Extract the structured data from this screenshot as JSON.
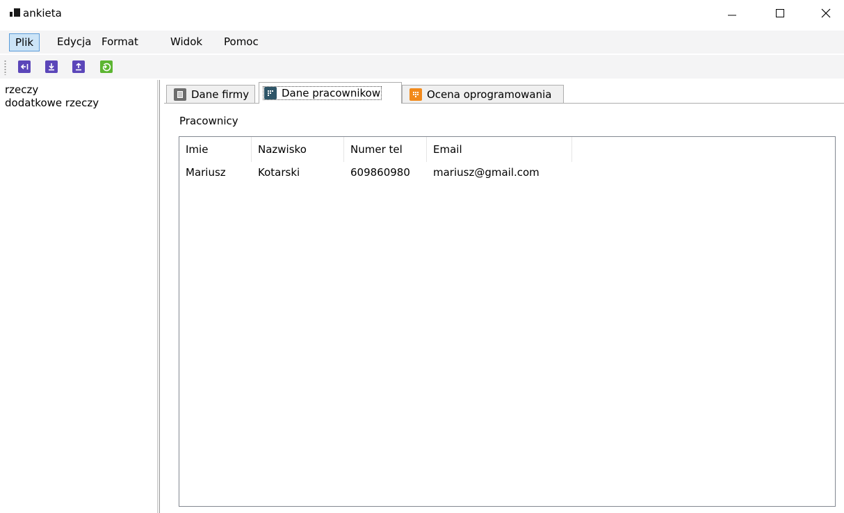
{
  "window": {
    "title": "ankieta",
    "controls": [
      "minimize-icon",
      "maximize-icon",
      "close-icon"
    ]
  },
  "menu": {
    "items": [
      {
        "label": "Plik",
        "active": true
      },
      {
        "label": "Edycja"
      },
      {
        "label": "Format"
      },
      {
        "label": "Widok"
      },
      {
        "label": "Pomoc"
      }
    ]
  },
  "toolbar": {
    "buttons": [
      {
        "icon": "exit-arrow-icon",
        "color": "#5b46b9"
      },
      {
        "icon": "download-icon",
        "color": "#5b46b9"
      },
      {
        "icon": "upload-icon",
        "color": "#5b46b9"
      },
      {
        "icon": "refresh-icon",
        "color": "#5cb531"
      }
    ]
  },
  "sidebar": {
    "items": [
      {
        "label": "rzeczy"
      },
      {
        "label": "dodatkowe rzeczy"
      }
    ]
  },
  "tabs": [
    {
      "label": "Dane firmy",
      "icon": "notebook-icon",
      "icon_color": "#6d6d6d",
      "selected": false
    },
    {
      "label": "Dane pracownikow",
      "icon": "grid-icon",
      "icon_color": "#2e5568",
      "selected": true
    },
    {
      "label": "Ocena oprogramowania",
      "icon": "grid-icon",
      "icon_color": "#f28a1b",
      "selected": false
    }
  ],
  "main": {
    "group_label": "Pracownicy",
    "list": {
      "columns": [
        "Imie",
        "Nazwisko",
        "Numer tel",
        "Email"
      ],
      "rows": [
        [
          "Mariusz",
          "Kotarski",
          "609860980",
          "mariusz@gmail.com"
        ]
      ]
    }
  }
}
